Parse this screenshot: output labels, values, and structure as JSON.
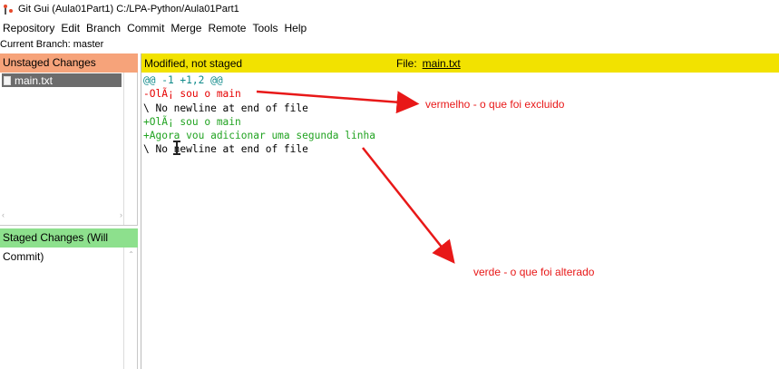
{
  "window": {
    "title": "Git Gui (Aula01Part1) C:/LPA-Python/Aula01Part1"
  },
  "menubar": {
    "items": [
      "Repository",
      "Edit",
      "Branch",
      "Commit",
      "Merge",
      "Remote",
      "Tools",
      "Help"
    ]
  },
  "branch": {
    "text": "Current Branch: master"
  },
  "unstaged": {
    "header": "Unstaged Changes",
    "files": [
      "main.txt"
    ]
  },
  "staged": {
    "header": "Staged Changes (Will Commit)"
  },
  "diff": {
    "status": "Modified, not staged",
    "file_label": "File:",
    "file_name": "main.txt",
    "lines": [
      "@@ -1 +1,2 @@",
      "-OlÃ¡ sou o main",
      "\\ No newline at end of file",
      "+OlÃ¡ sou o main",
      "+Agora vou adicionar uma segunda linha",
      "\\ No newline at end of file"
    ]
  },
  "annotations": {
    "red": "vermelho - o que foi excluido",
    "green": "verde - o que foi alterado",
    "color": "#e81818"
  },
  "colors": {
    "unstaged_header": "#f6a37a",
    "staged_header": "#8de08d",
    "diff_header": "#f2e200",
    "hunk": "#0f8a8a",
    "deleted": "#e60000",
    "added": "#21a321"
  }
}
